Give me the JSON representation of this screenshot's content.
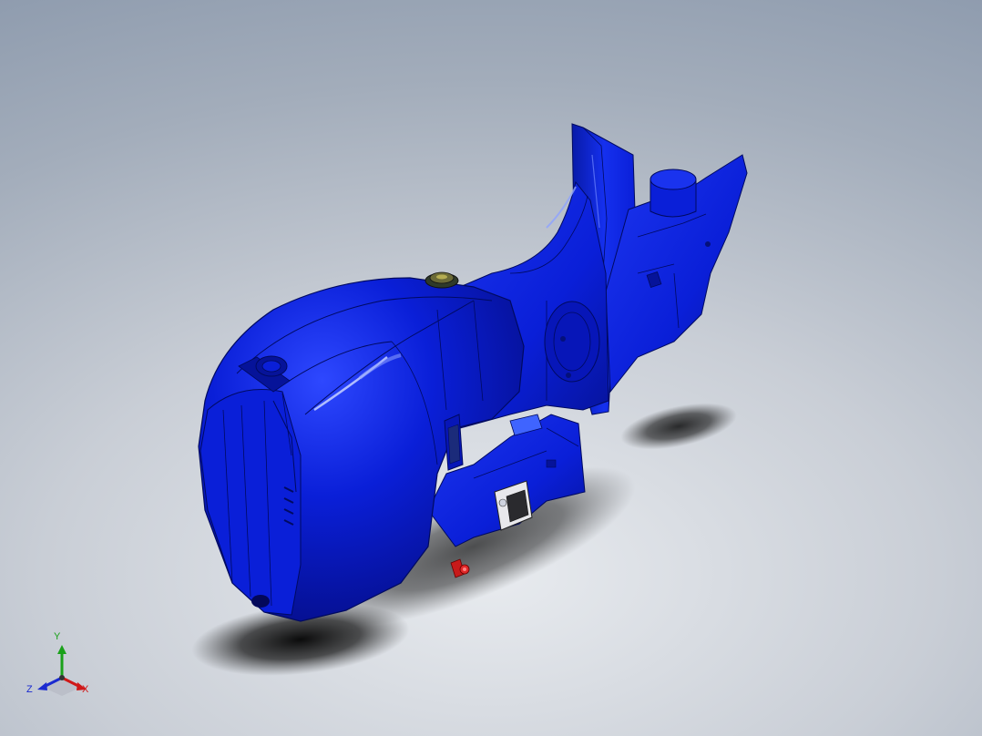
{
  "viewport": {
    "background_top": "#8896aa",
    "background_bottom": "#e8ebef"
  },
  "model": {
    "name_icon": "outboard-motor-model",
    "body_color": "#0a1fd8",
    "highlight_color": "#6f86ff",
    "edge_color": "#000a60"
  },
  "triad": {
    "x_label": "X",
    "y_label": "Y",
    "z_label": "Z",
    "x_color": "#d01818",
    "y_color": "#1aa11a",
    "z_color": "#1a2ad0"
  }
}
